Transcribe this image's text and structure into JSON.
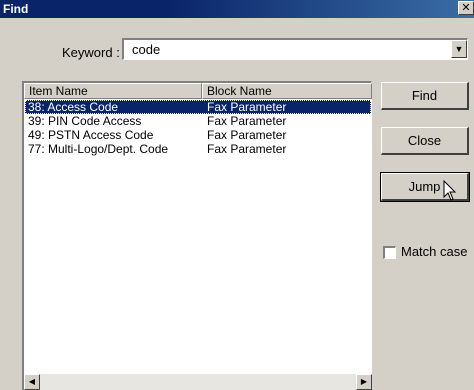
{
  "window": {
    "title": "Find",
    "close_symbol": "✕"
  },
  "keyword": {
    "label": "Keyword :",
    "value": "code"
  },
  "list": {
    "columns": [
      "Item Name",
      "Block Name"
    ],
    "rows": [
      {
        "item": "38: Access Code",
        "block": "Fax Parameter",
        "selected": true
      },
      {
        "item": "39: PIN Code Access",
        "block": "Fax Parameter",
        "selected": false
      },
      {
        "item": "49: PSTN Access Code",
        "block": "Fax Parameter",
        "selected": false
      },
      {
        "item": "77: Multi-Logo/Dept. Code",
        "block": "Fax Parameter",
        "selected": false
      }
    ]
  },
  "buttons": {
    "find": "Find",
    "close": "Close",
    "jump": "Jump"
  },
  "match_case": {
    "label": "Match case",
    "checked": false
  },
  "icons": {
    "drop": "dropdown-arrow-icon",
    "scroll_left": "scroll-left-icon",
    "scroll_right": "scroll-right-icon",
    "cursor": "mouse-pointer-icon"
  },
  "colors": {
    "titlebar": "#0a246a",
    "selection": "#0a246a",
    "face": "#d4d0c8"
  }
}
